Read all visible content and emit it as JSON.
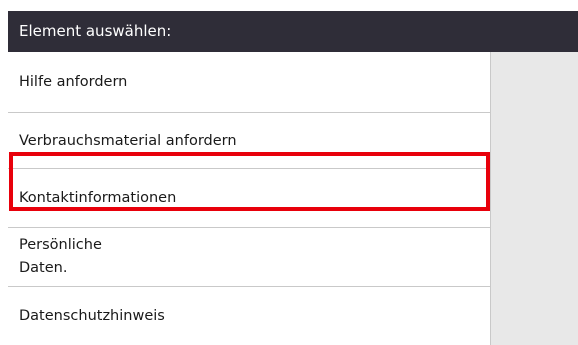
{
  "header": {
    "title": "Element auswählen:"
  },
  "menu": {
    "items": [
      {
        "label": "Hilfe anfordern"
      },
      {
        "label": "Verbrauchsmaterial anfordern"
      },
      {
        "label": "Kontaktinformationen"
      },
      {
        "label": "Persönliche\nDaten."
      },
      {
        "label": "Datenschutzhinweis"
      }
    ],
    "highlighted_index": 1
  },
  "colors": {
    "header_bg": "#2f2d38",
    "highlight_border": "#e8000b",
    "side_panel_bg": "#e8e8e8"
  }
}
